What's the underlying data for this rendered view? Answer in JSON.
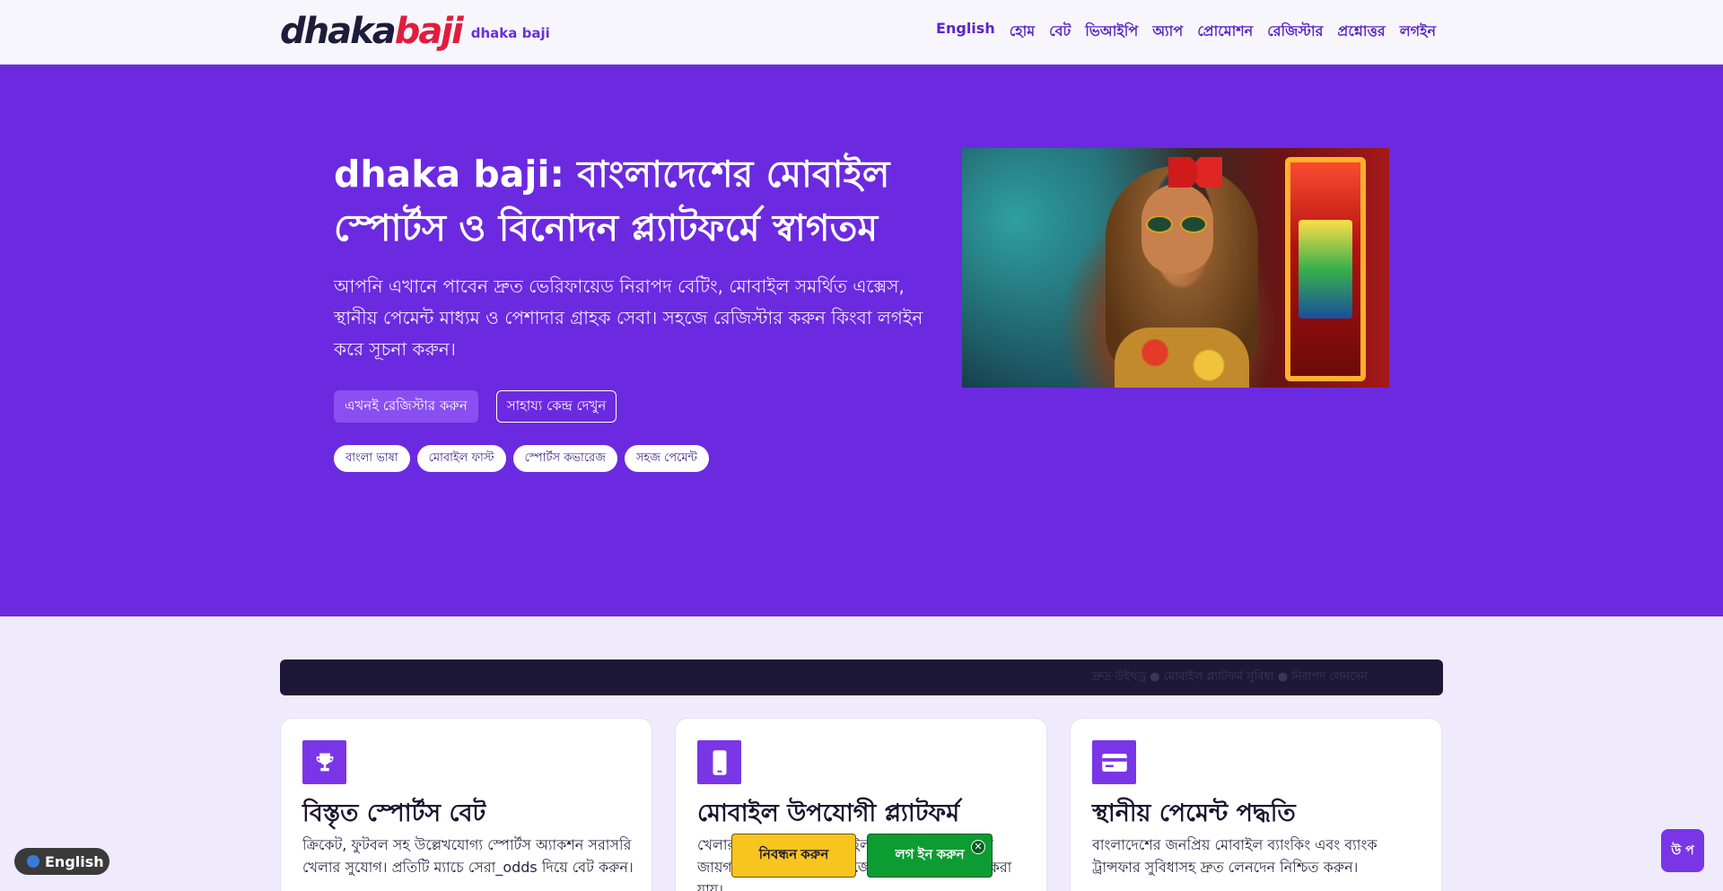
{
  "header": {
    "logo_part1": "dhaka",
    "logo_part2": "baji",
    "logo_subtitle": "dhaka baji",
    "nav": [
      "English",
      "হোম",
      "বেট",
      "ভিআইপি",
      "অ্যাপ",
      "প্রোমোশন",
      "রেজিস্টার",
      "প্রশ্নোত্তর",
      "লগইন"
    ]
  },
  "hero": {
    "title": "dhaka baji: বাংলাদেশের মোবাইল স্পোর্টস ও বিনোদন প্ল্যাটফর্মে স্বাগতম",
    "description": "আপনি এখানে পাবেন দ্রুত ভেরিফায়েড নিরাপদ বেটিং, মোবাইল সমর্থিত এক্সেস, স্থানীয় পেমেন্ট মাধ্যম ও পেশাদার গ্রাহক সেবা। সহজে রেজিস্টার করুন কিংবা লগইন করে সূচনা করুন।",
    "primary_button": "এখনই রেজিস্টার করুন",
    "secondary_button": "সাহায্য কেন্দ্র দেখুন",
    "chips": [
      "বাংলা ভাষা",
      "মোবাইল ফাস্ট",
      "স্পোর্টস কভারেজ",
      "সহজ পেমেন্ট"
    ]
  },
  "ticker": {
    "text": "দ্রুত উইথড্র ● মোবাইল প্ল্যাটফর্ম সুবিধা ● নিরাপদ লেনদেন"
  },
  "cards": [
    {
      "icon": "trophy-icon",
      "title": "বিস্তৃত স্পোর্টস বেট",
      "text": "ক্রিকেট, ফুটবল সহ উল্লেখযোগ্য স্পোর্টস অ্যাকশন সরাসরি খেলার সুযোগ। প্রতিটি ম্যাচে সেরা_odds দিয়ে বেট করুন।"
    },
    {
      "icon": "smartphone-icon",
      "title": "মোবাইল উপযোগী প্ল্যাটফর্ম",
      "text": "খেলার জন্য আধুনিক মোবাইল প্ল্যাটফর্ম যা যেকোনো জায়গা থেকে মোবাইলে সহজে প্রবেশ ও পরিচালনা করা যায়।"
    },
    {
      "icon": "card-icon",
      "title": "স্থানীয় পেমেন্ট পদ্ধতি",
      "text": "বাংলাদেশের জনপ্রিয় মোবাইল ব্যাংকিং এবং ব্যাংক ট্রান্সফার সুবিধাসহ দ্রুত লেনদেন নিশ্চিত করুন।"
    }
  ],
  "floating": {
    "register": "নিবন্ধন করুন",
    "login": "লগ ইন করুন",
    "close": "✕",
    "language": "English",
    "side_button": "উ প"
  },
  "colors": {
    "brand_purple": "#6c2ae0",
    "accent_yellow": "#f7c51e",
    "accent_green": "#0c9c32",
    "logo_red": "#e01d3d"
  }
}
